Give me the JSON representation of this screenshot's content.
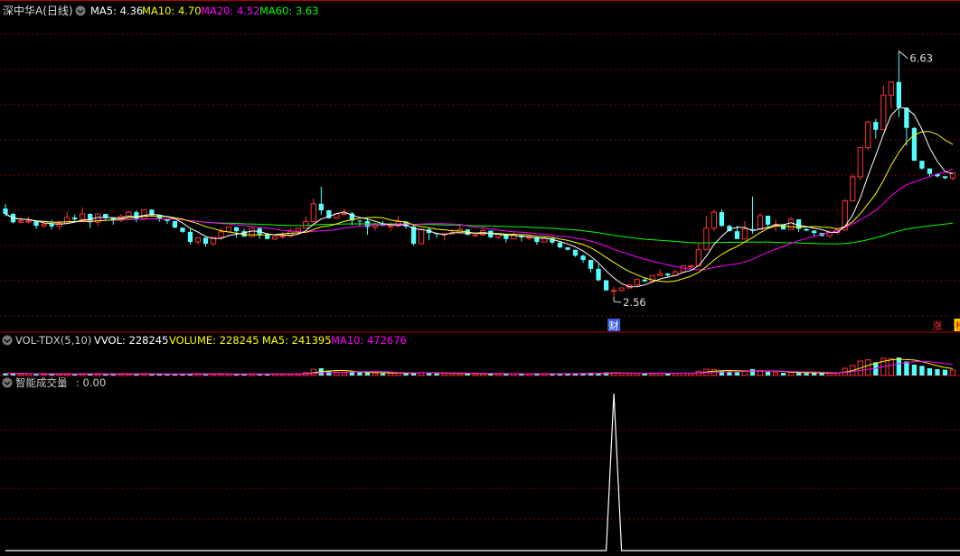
{
  "stock": {
    "title": "深中华A(日线)"
  },
  "main_panel": {
    "ma_legend": [
      {
        "label": "MA5: 4.36",
        "color": "#ffffff"
      },
      {
        "label": "MA10: 4.70",
        "color": "#ffff00"
      },
      {
        "label": "MA20: 4.52",
        "color": "#ff00ff"
      },
      {
        "label": "MA60: 3.63",
        "color": "#00ff00"
      }
    ],
    "high_label": "6.63",
    "low_label": "2.56",
    "markers": [
      {
        "text": "财",
        "bg": "#3b5bdb",
        "color": "#ffffff"
      },
      {
        "text": "涨",
        "bg": "#000000",
        "color": "#ff3333"
      },
      {
        "text": "榜",
        "bg": "#ffcc00",
        "color": "#cc0000"
      }
    ]
  },
  "vol_panel": {
    "legend": [
      {
        "label": "VOL-TDX(5,10)",
        "color": "#cccccc"
      },
      {
        "label": "VVOL: 228245",
        "color": "#ffffff"
      },
      {
        "label": "VOLUME: 228245",
        "color": "#ffff00"
      },
      {
        "label": "MA5: 241395",
        "color": "#ffff00"
      },
      {
        "label": "MA10: 472676",
        "color": "#ff00ff"
      }
    ]
  },
  "ind_panel": {
    "title": "智能成交量",
    "value_label": ": 0.00"
  },
  "colors": {
    "up": "#ff3232",
    "down": "#54ffff",
    "grid": "#7a0000",
    "divider": "#aa0000",
    "ma5": "#ffffff",
    "ma10": "#ffff00",
    "ma20": "#ff00ff",
    "ma60": "#00ff00"
  },
  "chart_data": {
    "type": "candlestick",
    "scale": {
      "price_min": 2.0,
      "price_max": 7.2,
      "volume_max": 900000,
      "indicator_max": 1.0
    },
    "candles": [
      [
        4.04,
        3.95,
        4.12,
        3.91
      ],
      [
        3.95,
        3.81,
        3.97,
        3.79
      ],
      [
        3.81,
        3.83,
        3.89,
        3.79
      ],
      [
        3.83,
        3.83,
        3.9,
        3.79
      ],
      [
        3.83,
        3.75,
        3.84,
        3.7
      ],
      [
        3.75,
        3.78,
        3.79,
        3.72
      ],
      [
        3.78,
        3.74,
        3.85,
        3.69
      ],
      [
        3.74,
        3.79,
        3.84,
        3.68
      ],
      [
        3.79,
        3.89,
        3.99,
        3.81
      ],
      [
        3.89,
        3.86,
        3.94,
        3.82
      ],
      [
        3.86,
        3.95,
        4.06,
        3.86
      ],
      [
        3.95,
        3.81,
        3.96,
        3.71
      ],
      [
        3.81,
        3.95,
        3.96,
        3.75
      ],
      [
        3.95,
        3.88,
        3.9,
        3.85
      ],
      [
        3.88,
        3.85,
        3.88,
        3.77
      ],
      [
        3.85,
        3.91,
        3.95,
        3.81
      ],
      [
        3.91,
        3.98,
        4.0,
        3.91
      ],
      [
        3.98,
        3.87,
        4.01,
        3.81
      ],
      [
        3.87,
        4.02,
        4.03,
        3.84
      ],
      [
        4.02,
        3.93,
        4.03,
        3.91
      ],
      [
        3.93,
        3.86,
        3.91,
        3.82
      ],
      [
        3.86,
        3.83,
        3.83,
        3.78
      ],
      [
        3.83,
        3.72,
        3.83,
        3.71
      ],
      [
        3.72,
        3.65,
        3.72,
        3.63
      ],
      [
        3.65,
        3.48,
        3.7,
        3.44
      ],
      [
        3.48,
        3.55,
        3.54,
        3.44
      ],
      [
        3.55,
        3.45,
        3.54,
        3.4
      ],
      [
        3.45,
        3.56,
        3.57,
        3.42
      ],
      [
        3.56,
        3.65,
        3.72,
        3.52
      ],
      [
        3.65,
        3.73,
        3.71,
        3.63
      ],
      [
        3.73,
        3.66,
        3.73,
        3.55
      ],
      [
        3.66,
        3.57,
        3.7,
        3.57
      ],
      [
        3.57,
        3.71,
        3.71,
        3.56
      ],
      [
        3.71,
        3.61,
        3.72,
        3.53
      ],
      [
        3.61,
        3.53,
        3.63,
        3.53
      ],
      [
        3.53,
        3.57,
        3.57,
        3.51
      ],
      [
        3.57,
        3.58,
        3.64,
        3.53
      ],
      [
        3.58,
        3.66,
        3.72,
        3.56
      ],
      [
        3.66,
        3.71,
        3.71,
        3.61
      ],
      [
        3.71,
        3.82,
        3.91,
        3.71
      ],
      [
        3.82,
        4.12,
        4.21,
        3.8
      ],
      [
        4.12,
        4.01,
        4.41,
        3.94
      ],
      [
        4.01,
        3.88,
        4.02,
        3.87
      ],
      [
        3.88,
        3.95,
        3.97,
        3.93
      ],
      [
        3.95,
        3.96,
        4.03,
        3.91
      ],
      [
        3.96,
        3.84,
        3.98,
        3.76
      ],
      [
        3.84,
        3.83,
        3.84,
        3.75
      ],
      [
        3.83,
        3.73,
        3.89,
        3.6
      ],
      [
        3.73,
        3.78,
        3.8,
        3.67
      ],
      [
        3.78,
        3.75,
        3.83,
        3.75
      ],
      [
        3.75,
        3.75,
        3.81,
        3.66
      ],
      [
        3.75,
        3.82,
        3.92,
        3.72
      ],
      [
        3.82,
        3.74,
        3.83,
        3.7
      ],
      [
        3.74,
        3.45,
        3.78,
        3.42
      ],
      [
        3.45,
        3.69,
        3.71,
        3.45
      ],
      [
        3.69,
        3.63,
        3.71,
        3.51
      ],
      [
        3.63,
        3.61,
        3.6,
        3.55
      ],
      [
        3.61,
        3.62,
        3.6,
        3.51
      ],
      [
        3.62,
        3.63,
        3.7,
        3.62
      ],
      [
        3.63,
        3.69,
        3.76,
        3.68
      ],
      [
        3.69,
        3.6,
        3.67,
        3.59
      ],
      [
        3.6,
        3.6,
        3.6,
        3.57
      ],
      [
        3.6,
        3.67,
        3.75,
        3.58
      ],
      [
        3.67,
        3.56,
        3.65,
        3.54
      ],
      [
        3.56,
        3.61,
        3.6,
        3.53
      ],
      [
        3.61,
        3.53,
        3.57,
        3.47
      ],
      [
        3.53,
        3.59,
        3.64,
        3.54
      ],
      [
        3.59,
        3.56,
        3.6,
        3.49
      ],
      [
        3.56,
        3.56,
        3.57,
        3.51
      ],
      [
        3.56,
        3.48,
        3.58,
        3.43
      ],
      [
        3.48,
        3.54,
        3.56,
        3.5
      ],
      [
        3.54,
        3.47,
        3.56,
        3.44
      ],
      [
        3.47,
        3.39,
        3.48,
        3.37
      ],
      [
        3.39,
        3.35,
        3.39,
        3.34
      ],
      [
        3.35,
        3.25,
        3.35,
        3.23
      ],
      [
        3.25,
        3.18,
        3.27,
        3.13
      ],
      [
        3.18,
        3.03,
        3.18,
        2.97
      ],
      [
        3.03,
        2.84,
        3.11,
        2.82
      ],
      [
        2.84,
        2.67,
        2.84,
        2.66
      ],
      [
        2.67,
        2.67,
        2.73,
        2.56
      ],
      [
        2.67,
        2.71,
        2.72,
        2.65
      ],
      [
        2.71,
        2.76,
        2.77,
        2.71
      ],
      [
        2.76,
        2.85,
        2.87,
        2.75
      ],
      [
        2.85,
        2.82,
        2.88,
        2.81
      ],
      [
        2.82,
        2.92,
        2.91,
        2.79
      ],
      [
        2.92,
        2.95,
        3.02,
        2.92
      ],
      [
        2.95,
        2.92,
        2.96,
        2.89
      ],
      [
        2.92,
        2.98,
        3.02,
        2.91
      ],
      [
        2.98,
        3.08,
        3.09,
        2.97
      ],
      [
        3.08,
        3.08,
        3.1,
        3.02
      ],
      [
        3.08,
        3.35,
        3.45,
        3.07
      ],
      [
        3.35,
        3.71,
        3.91,
        3.35
      ],
      [
        3.71,
        3.98,
        4.02,
        3.66
      ],
      [
        3.98,
        3.75,
        4.03,
        3.73
      ],
      [
        3.75,
        3.66,
        3.77,
        3.66
      ],
      [
        3.66,
        3.53,
        3.75,
        3.53
      ],
      [
        3.53,
        3.7,
        3.83,
        3.53
      ],
      [
        3.7,
        3.69,
        4.24,
        3.62
      ],
      [
        3.69,
        3.92,
        3.97,
        3.75
      ],
      [
        3.92,
        3.77,
        3.88,
        3.73
      ],
      [
        3.77,
        3.77,
        3.85,
        3.66
      ],
      [
        3.77,
        3.69,
        3.72,
        3.69
      ],
      [
        3.69,
        3.86,
        3.9,
        3.81
      ],
      [
        3.86,
        3.7,
        3.81,
        3.65
      ],
      [
        3.7,
        3.67,
        3.67,
        3.66
      ],
      [
        3.67,
        3.63,
        3.68,
        3.58
      ],
      [
        3.63,
        3.58,
        3.63,
        3.57
      ],
      [
        3.58,
        3.64,
        3.68,
        3.55
      ],
      [
        3.64,
        3.68,
        3.71,
        3.61
      ],
      [
        3.68,
        4.17,
        4.2,
        3.68
      ],
      [
        4.17,
        4.57,
        4.62,
        4.17
      ],
      [
        4.57,
        5.06,
        5.03,
        4.52
      ],
      [
        5.06,
        5.49,
        5.51,
        5.01
      ],
      [
        5.49,
        5.36,
        5.54,
        5.21
      ],
      [
        5.36,
        5.94,
        6.1,
        5.36
      ],
      [
        5.94,
        6.16,
        6.15,
        5.72
      ],
      [
        6.16,
        5.73,
        6.63,
        5.57
      ],
      [
        5.73,
        5.39,
        5.4,
        5.09
      ],
      [
        5.39,
        4.84,
        5.4,
        4.86
      ],
      [
        4.84,
        4.71,
        4.79,
        4.69
      ],
      [
        4.71,
        4.62,
        4.68,
        4.57
      ],
      [
        4.62,
        4.58,
        4.61,
        4.56
      ],
      [
        4.58,
        4.55,
        4.56,
        4.53
      ],
      [
        4.55,
        4.64,
        4.65,
        4.51
      ]
    ],
    "volume": [
      90000,
      85000,
      70000,
      75000,
      60000,
      55000,
      60000,
      58000,
      65000,
      62000,
      70000,
      75000,
      60000,
      55000,
      58000,
      62000,
      68000,
      60000,
      65000,
      60000,
      58000,
      55000,
      60000,
      65000,
      70000,
      62000,
      60000,
      58000,
      62000,
      60000,
      55000,
      58000,
      60000,
      62000,
      58000,
      55000,
      58000,
      60000,
      65000,
      120000,
      260000,
      300000,
      200000,
      150000,
      120000,
      140000,
      130000,
      120000,
      100000,
      90000,
      95000,
      110000,
      100000,
      130000,
      120000,
      100000,
      90000,
      85000,
      80000,
      85000,
      80000,
      75000,
      80000,
      78000,
      72000,
      70000,
      75000,
      70000,
      68000,
      70000,
      72000,
      75000,
      80000,
      78000,
      90000,
      85000,
      110000,
      95000,
      120000,
      105000,
      90000,
      85000,
      90000,
      85000,
      90000,
      95000,
      88000,
      95000,
      100000,
      90000,
      180000,
      260000,
      250000,
      200000,
      150000,
      130000,
      180000,
      260000,
      200000,
      150000,
      120000,
      110000,
      140000,
      120000,
      100000,
      95000,
      90000,
      100000,
      110000,
      300000,
      420000,
      600000,
      650000,
      550000,
      720000,
      700000,
      750000,
      580000,
      450000,
      400000,
      300000,
      260000,
      240000,
      228245
    ],
    "indicator": [
      0,
      0,
      0,
      0,
      0,
      0,
      0,
      0,
      0,
      0,
      0,
      0,
      0,
      0,
      0,
      0,
      0,
      0,
      0,
      0,
      0,
      0,
      0,
      0,
      0,
      0,
      0,
      0,
      0,
      0,
      0,
      0,
      0,
      0,
      0,
      0,
      0,
      0,
      0,
      0,
      0,
      0,
      0,
      0,
      0,
      0,
      0,
      0,
      0,
      0,
      0,
      0,
      0,
      0,
      0,
      0,
      0,
      0,
      0,
      0,
      0,
      0,
      0,
      0,
      0,
      0,
      0,
      0,
      0,
      0,
      0,
      0,
      0,
      0,
      0,
      0,
      0,
      0,
      0,
      1,
      0,
      0,
      0,
      0,
      0,
      0,
      0,
      0,
      0,
      0,
      0,
      0,
      0,
      0,
      0,
      0,
      0,
      0,
      0,
      0,
      0,
      0,
      0,
      0,
      0,
      0,
      0,
      0,
      0,
      0,
      0,
      0,
      0,
      0,
      0,
      0,
      0,
      0,
      0,
      0,
      0,
      0,
      0,
      0,
      0,
      0,
      0,
      0,
      0,
      0
    ]
  }
}
